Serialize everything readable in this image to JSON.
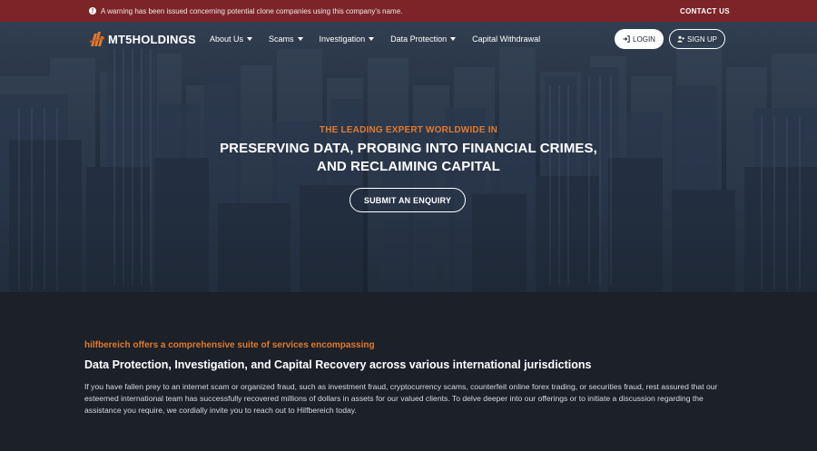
{
  "warning_bar": {
    "message": "A warning has been issued concerning potential clone companies using this company's name.",
    "contact_label": "CONTACT US"
  },
  "logo": {
    "text": "MT5HOLDINGS"
  },
  "nav": {
    "items": [
      {
        "label": "About Us",
        "has_dropdown": true
      },
      {
        "label": "Scams",
        "has_dropdown": true
      },
      {
        "label": "Investigation",
        "has_dropdown": true
      },
      {
        "label": "Data Protection",
        "has_dropdown": true
      },
      {
        "label": "Capital Withdrawal",
        "has_dropdown": false
      }
    ],
    "login_label": "LOGIN",
    "signup_label": "SIGN UP"
  },
  "hero": {
    "kicker": "THE LEADING EXPERT WORLDWIDE IN",
    "title_line1": "PRESERVING DATA, PROBING INTO FINANCIAL CRIMES,",
    "title_line2": "AND RECLAIMING CAPITAL",
    "cta_label": "SUBMIT AN ENQUIRY"
  },
  "content": {
    "subhead": "hilfbereich offers a comprehensive suite of services encompassing",
    "headline": "Data Protection, Investigation, and Capital Recovery across various international jurisdictions",
    "body": "If you have fallen prey to an internet scam or organized fraud, such as investment fraud, cryptocurrency scams, counterfeit online forex trading, or securities fraud, rest assured that our esteemed international team has successfully recovered millions of dollars in assets for our valued clients. To delve deeper into our offerings or to initiate a discussion regarding the assistance you require, we cordially invite you to reach out to Hilfbereich today."
  },
  "colors": {
    "warning_bg": "#7c2428",
    "accent_orange": "#e07a2e",
    "content_bg": "#1b2029"
  },
  "icons": {
    "warning": "info-circle-icon",
    "login": "sign-in-icon",
    "signup": "user-plus-icon",
    "logo_mark": "logo-mark-icon"
  }
}
